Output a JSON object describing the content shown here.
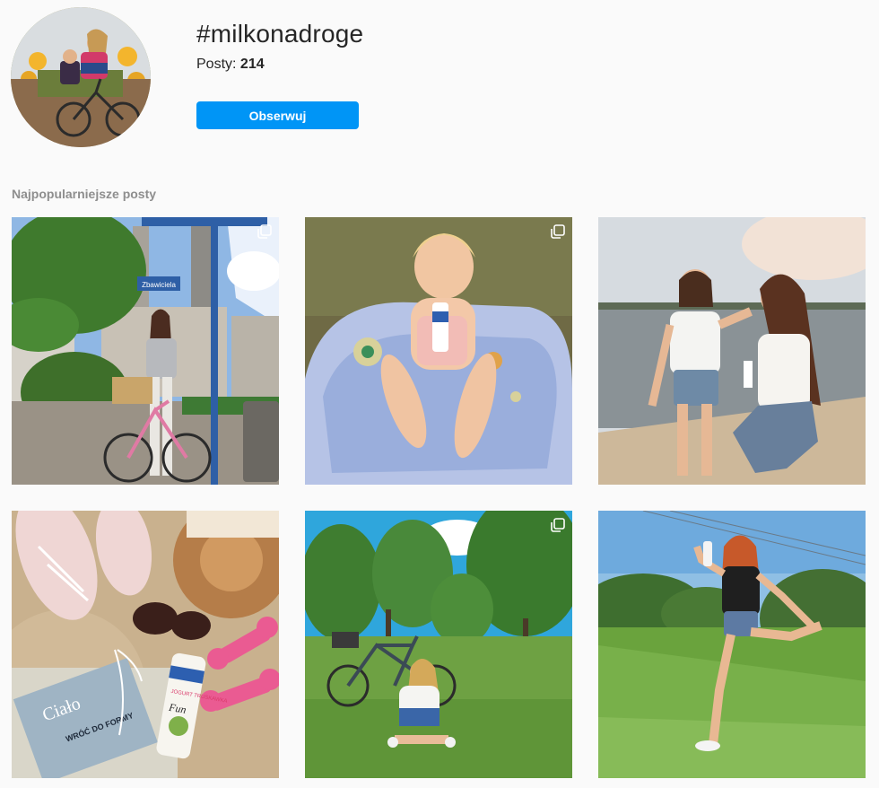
{
  "header": {
    "hashtag": "#milkonadroge",
    "posts_label": "Posty:",
    "posts_count": "214",
    "follow_label": "Obserwuj",
    "accent_color": "#0095f6"
  },
  "section": {
    "title": "Najpopularniejsze posty"
  },
  "posts": [
    {
      "label": "city-bicycle-woman-photo",
      "icon": "multi-photo-icon",
      "multi": true
    },
    {
      "label": "baby-in-pool-photo",
      "icon": "multi-photo-icon",
      "multi": true
    },
    {
      "label": "mother-daughter-beach-photo",
      "icon": "",
      "multi": false
    },
    {
      "label": "beach-flatlay-photo",
      "icon": "",
      "multi": false
    },
    {
      "label": "woman-with-bicycle-park-photo",
      "icon": "multi-photo-icon",
      "multi": true
    },
    {
      "label": "woman-pose-meadow-photo",
      "icon": "",
      "multi": false
    }
  ],
  "photo_texts": {
    "street_sign": "Zbawiciela",
    "magazine_title": "Ciało",
    "magazine_cover": "WRÓĆ DO FORMY",
    "bottle_text": "JOGURT TRUSKAWKA",
    "bottle_brand": "Fun"
  }
}
